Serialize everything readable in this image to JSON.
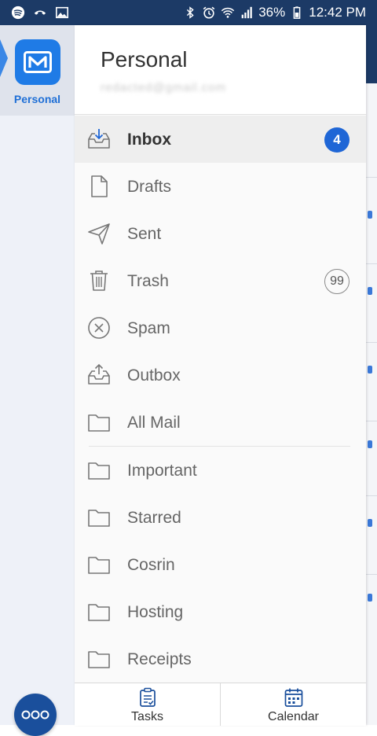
{
  "status_bar": {
    "battery": "36%",
    "time": "12:42 PM"
  },
  "rail": {
    "account_label": "Personal"
  },
  "drawer": {
    "account_name": "Personal",
    "account_email": "redacted@gmail.com"
  },
  "folders": [
    {
      "label": "Inbox",
      "icon": "inbox-icon",
      "badge": "4",
      "badge_style": "filled",
      "active": true
    },
    {
      "label": "Drafts",
      "icon": "draft-icon"
    },
    {
      "label": "Sent",
      "icon": "sent-icon"
    },
    {
      "label": "Trash",
      "icon": "trash-icon",
      "badge": "99",
      "badge_style": "outline"
    },
    {
      "label": "Spam",
      "icon": "spam-icon"
    },
    {
      "label": "Outbox",
      "icon": "outbox-icon"
    },
    {
      "label": "All Mail",
      "icon": "folder-icon"
    },
    {
      "label": "Important",
      "icon": "folder-icon"
    },
    {
      "label": "Starred",
      "icon": "folder-icon"
    },
    {
      "label": "Cosrin",
      "icon": "folder-icon"
    },
    {
      "label": "Hosting",
      "icon": "folder-icon"
    },
    {
      "label": "Receipts",
      "icon": "folder-icon"
    }
  ],
  "bottom_bar": {
    "tasks_label": "Tasks",
    "calendar_label": "Calendar"
  },
  "colors": {
    "accent": "#1f66d6",
    "status_bar": "#1c3a66"
  }
}
